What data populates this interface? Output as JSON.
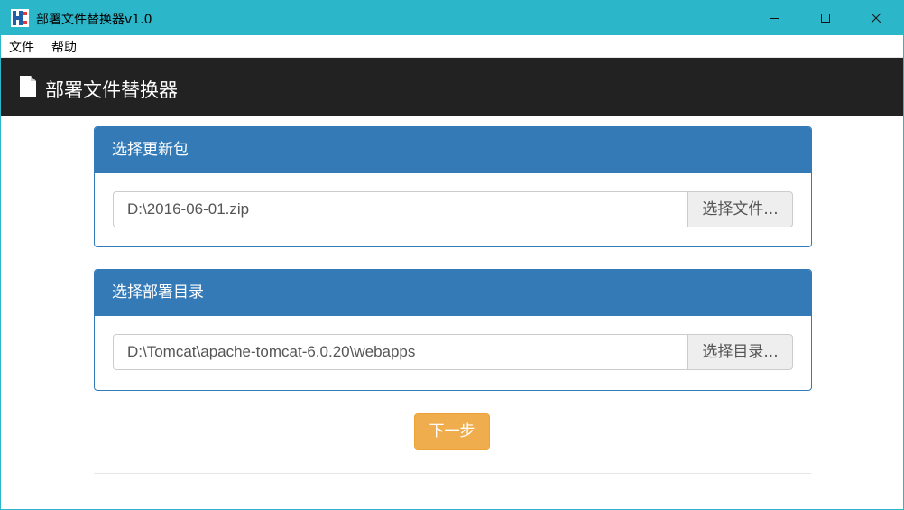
{
  "window": {
    "title": "部署文件替换器v1.0",
    "accent": "#2bb7c9",
    "controls": [
      "minimize-icon",
      "maximize-icon",
      "close-icon"
    ]
  },
  "menu": {
    "items": [
      {
        "label": "文件"
      },
      {
        "label": "帮助"
      }
    ]
  },
  "header": {
    "icon": "file-icon",
    "title": "部署文件替换器",
    "background": "#222222"
  },
  "panels": [
    {
      "heading": "选择更新包",
      "input_value": "D:\\2016-06-01.zip",
      "button_label": "选择文件..."
    },
    {
      "heading": "选择部署目录",
      "input_value": "D:\\Tomcat\\apache-tomcat-6.0.20\\webapps",
      "button_label": "选择目录..."
    }
  ],
  "next_button": {
    "label": "下一步",
    "color": "#f0ad4e"
  },
  "colors": {
    "panel_primary": "#337ab7"
  }
}
